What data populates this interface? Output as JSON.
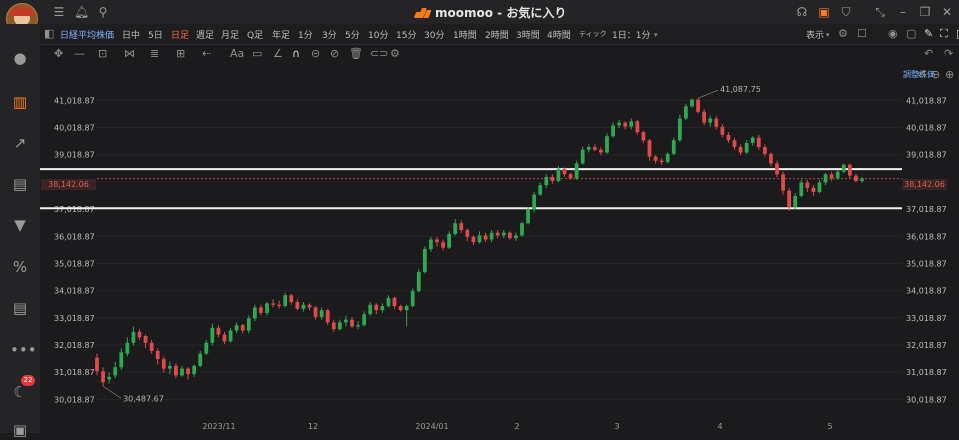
{
  "app": {
    "title": "moomoo - お気に入り",
    "accent": "#ff7a1a"
  },
  "titlebar": {
    "left_icons": [
      "menu-icon",
      "bell-icon",
      "search-icon"
    ],
    "right_icons": [
      "headset-icon",
      "lock-icon",
      "shirt-icon",
      "collapse-icon",
      "minimize-icon",
      "restore-icon",
      "close-icon"
    ]
  },
  "sidebar": {
    "items": [
      {
        "name": "user-icon",
        "glyph": "👤"
      },
      {
        "name": "chart-bar-icon",
        "glyph": "▥"
      },
      {
        "name": "trend-icon",
        "glyph": "↗"
      },
      {
        "name": "analysis-icon",
        "glyph": "▤"
      },
      {
        "name": "filter-icon",
        "glyph": "▼"
      },
      {
        "name": "percent-icon",
        "glyph": "%"
      },
      {
        "name": "document-icon",
        "glyph": "▤"
      },
      {
        "name": "chat-icon",
        "glyph": "…"
      },
      {
        "name": "moon-icon",
        "glyph": "☾"
      },
      {
        "name": "more-icon",
        "glyph": "▣"
      }
    ],
    "badge_count": "22"
  },
  "toolbar": {
    "symbol": "日経平均株価",
    "timeframes": [
      "日中",
      "5日",
      "日足",
      "週足",
      "月足",
      "Q足",
      "年足",
      "1分",
      "3分",
      "5分",
      "10分",
      "15分",
      "30分",
      "1時間",
      "2時間",
      "3時間",
      "4時間",
      "ティック",
      "1日：1分"
    ],
    "active_timeframe": "日足",
    "display_label": "表示"
  },
  "chart": {
    "adjusted_label": "調整株価",
    "price_labels": [
      "41,018.87",
      "40,018.87",
      "39,018.87",
      "38,142.06",
      "37,018.87",
      "36,018.87",
      "35,018.87",
      "34,018.87",
      "33,018.87",
      "32,018.87",
      "31,018.87",
      "30,018.87"
    ],
    "date_labels": [
      "2023/11",
      "12",
      "2024/01",
      "2",
      "3",
      "4",
      "5"
    ],
    "current_price": "38,142.06",
    "high_annotation": "41,087.75",
    "low_annotation": "30,487.67"
  },
  "chart_data": {
    "type": "candlestick",
    "title": "日経平均株価",
    "ylim": [
      29700,
      42100
    ],
    "gridlines": true,
    "horizontal_lines": [
      38490,
      37050
    ],
    "current_price": 38142.06,
    "high": 41087.75,
    "low": 30487.67,
    "up_color": "#2fa84f",
    "down_color": "#e04a4a",
    "candles": [
      [
        31550,
        31050,
        31700,
        30900
      ],
      [
        31050,
        30650,
        31200,
        30500
      ],
      [
        30750,
        30850,
        31000,
        30600
      ],
      [
        30900,
        31200,
        31400,
        30800
      ],
      [
        31200,
        31750,
        31900,
        31100
      ],
      [
        31700,
        32100,
        32300,
        31600
      ],
      [
        32100,
        32500,
        32700,
        32000
      ],
      [
        32500,
        32300,
        32600,
        32200
      ],
      [
        32350,
        32100,
        32400,
        31900
      ],
      [
        32100,
        31800,
        32200,
        31700
      ],
      [
        31800,
        31500,
        31900,
        31300
      ],
      [
        31500,
        31150,
        31600,
        31000
      ],
      [
        31150,
        31250,
        31400,
        30950
      ],
      [
        31250,
        30900,
        31350,
        30800
      ],
      [
        30900,
        31150,
        31250,
        30850
      ],
      [
        31150,
        30950,
        31200,
        30750
      ],
      [
        30950,
        31250,
        31300,
        30850
      ],
      [
        31250,
        31700,
        31800,
        31200
      ],
      [
        31700,
        32100,
        32200,
        31650
      ],
      [
        32100,
        32650,
        32800,
        32000
      ],
      [
        32650,
        32400,
        32750,
        32300
      ],
      [
        32400,
        32150,
        32500,
        32050
      ],
      [
        32150,
        32550,
        32650,
        32100
      ],
      [
        32550,
        32750,
        32850,
        32450
      ],
      [
        32750,
        32550,
        32800,
        32450
      ],
      [
        32550,
        33000,
        33100,
        32450
      ],
      [
        33000,
        33400,
        33500,
        32900
      ],
      [
        33400,
        33200,
        33500,
        33100
      ],
      [
        33200,
        33550,
        33600,
        33100
      ],
      [
        33550,
        33500,
        33700,
        33400
      ],
      [
        33500,
        33450,
        33650,
        33350
      ],
      [
        33450,
        33850,
        33950,
        33400
      ],
      [
        33850,
        33600,
        33900,
        33500
      ],
      [
        33600,
        33350,
        33700,
        33300
      ],
      [
        33350,
        33500,
        33600,
        33250
      ],
      [
        33500,
        33400,
        33550,
        33300
      ],
      [
        33400,
        33050,
        33450,
        32950
      ],
      [
        33050,
        33300,
        33400,
        32950
      ],
      [
        33300,
        32850,
        33350,
        32750
      ],
      [
        32850,
        32600,
        32950,
        32500
      ],
      [
        32600,
        32850,
        32950,
        32550
      ],
      [
        32850,
        32950,
        33100,
        32700
      ],
      [
        32950,
        32700,
        33050,
        32650
      ],
      [
        32700,
        32750,
        32900,
        32600
      ],
      [
        32750,
        33150,
        33250,
        32700
      ],
      [
        33150,
        33500,
        33600,
        33100
      ],
      [
        33500,
        33300,
        33550,
        33150
      ],
      [
        33300,
        33450,
        33550,
        33200
      ],
      [
        33450,
        33750,
        33850,
        33400
      ],
      [
        33750,
        33450,
        33800,
        33350
      ],
      [
        33450,
        33300,
        33500,
        33250
      ],
      [
        33300,
        33450,
        33500,
        32700
      ],
      [
        33450,
        34000,
        34100,
        33400
      ],
      [
        34000,
        34700,
        34800,
        33950
      ],
      [
        34700,
        35550,
        35650,
        34650
      ],
      [
        35550,
        35900,
        36000,
        35450
      ],
      [
        35900,
        35800,
        36000,
        35650
      ],
      [
        35800,
        35600,
        35900,
        35500
      ],
      [
        35600,
        36100,
        36200,
        35550
      ],
      [
        36100,
        36500,
        36650,
        36050
      ],
      [
        36500,
        36250,
        36600,
        36150
      ],
      [
        36250,
        36000,
        36300,
        35850
      ],
      [
        36000,
        35800,
        36050,
        35700
      ],
      [
        35800,
        36050,
        36200,
        35750
      ],
      [
        36050,
        35900,
        36150,
        35800
      ],
      [
        35900,
        36150,
        36250,
        35800
      ],
      [
        36150,
        36050,
        36250,
        35950
      ],
      [
        36050,
        36150,
        36250,
        35950
      ],
      [
        36150,
        35950,
        36200,
        35900
      ],
      [
        35950,
        36050,
        36150,
        35850
      ],
      [
        36050,
        36500,
        36550,
        36000
      ],
      [
        36500,
        37000,
        37100,
        36450
      ],
      [
        37000,
        37550,
        37650,
        36900
      ],
      [
        37550,
        37900,
        38000,
        37500
      ],
      [
        37900,
        38200,
        38300,
        37800
      ],
      [
        38200,
        38050,
        38300,
        37950
      ],
      [
        38050,
        38500,
        38600,
        38000
      ],
      [
        38500,
        38300,
        38550,
        38200
      ],
      [
        38300,
        38150,
        38350,
        38100
      ],
      [
        38150,
        38700,
        38800,
        38100
      ],
      [
        38700,
        39200,
        39300,
        38650
      ],
      [
        39200,
        39300,
        39400,
        39100
      ],
      [
        39300,
        39200,
        39400,
        39150
      ],
      [
        39200,
        39100,
        39300,
        39000
      ],
      [
        39100,
        39700,
        39800,
        39050
      ],
      [
        39700,
        40100,
        40200,
        39650
      ],
      [
        40100,
        40200,
        40300,
        40000
      ],
      [
        40200,
        40050,
        40250,
        39950
      ],
      [
        40050,
        40250,
        40350,
        39950
      ],
      [
        40250,
        39850,
        40300,
        39750
      ],
      [
        39850,
        39550,
        39900,
        39450
      ],
      [
        39550,
        38950,
        39600,
        38800
      ],
      [
        38950,
        38800,
        39000,
        38700
      ],
      [
        38800,
        38750,
        38900,
        38650
      ],
      [
        38750,
        39050,
        39100,
        38700
      ],
      [
        39050,
        39550,
        39650,
        39000
      ],
      [
        39550,
        40350,
        40500,
        39500
      ],
      [
        40350,
        40800,
        40900,
        40300
      ],
      [
        40800,
        41050,
        41087.75,
        40750
      ],
      [
        41050,
        40600,
        41100,
        40550
      ],
      [
        40600,
        40200,
        40700,
        40100
      ],
      [
        40200,
        40350,
        40450,
        40050
      ],
      [
        40350,
        40050,
        40450,
        39950
      ],
      [
        40050,
        39750,
        40150,
        39650
      ],
      [
        39750,
        39550,
        39850,
        39450
      ],
      [
        39550,
        39300,
        39650,
        39200
      ],
      [
        39300,
        39100,
        39400,
        39000
      ],
      [
        39100,
        39450,
        39550,
        39050
      ],
      [
        39450,
        39650,
        39700,
        39350
      ],
      [
        39650,
        39300,
        39750,
        39200
      ],
      [
        39300,
        39050,
        39400,
        38950
      ],
      [
        39050,
        38700,
        39100,
        38600
      ],
      [
        38700,
        38300,
        38800,
        38200
      ],
      [
        38300,
        37700,
        38400,
        37550
      ],
      [
        37700,
        37100,
        37800,
        36950
      ],
      [
        37100,
        37500,
        37600,
        37000
      ],
      [
        37500,
        38000,
        38100,
        37450
      ],
      [
        38000,
        37800,
        38100,
        37650
      ],
      [
        37800,
        37650,
        37900,
        37500
      ],
      [
        37650,
        38000,
        38100,
        37600
      ],
      [
        38000,
        38300,
        38350,
        37900
      ],
      [
        38300,
        38150,
        38400,
        38050
      ],
      [
        38150,
        38400,
        38450,
        38100
      ],
      [
        38400,
        38650,
        38700,
        38350
      ],
      [
        38650,
        38250,
        38700,
        38150
      ],
      [
        38250,
        38050,
        38300,
        38000
      ],
      [
        38050,
        38142.06,
        38200,
        37980
      ]
    ]
  }
}
